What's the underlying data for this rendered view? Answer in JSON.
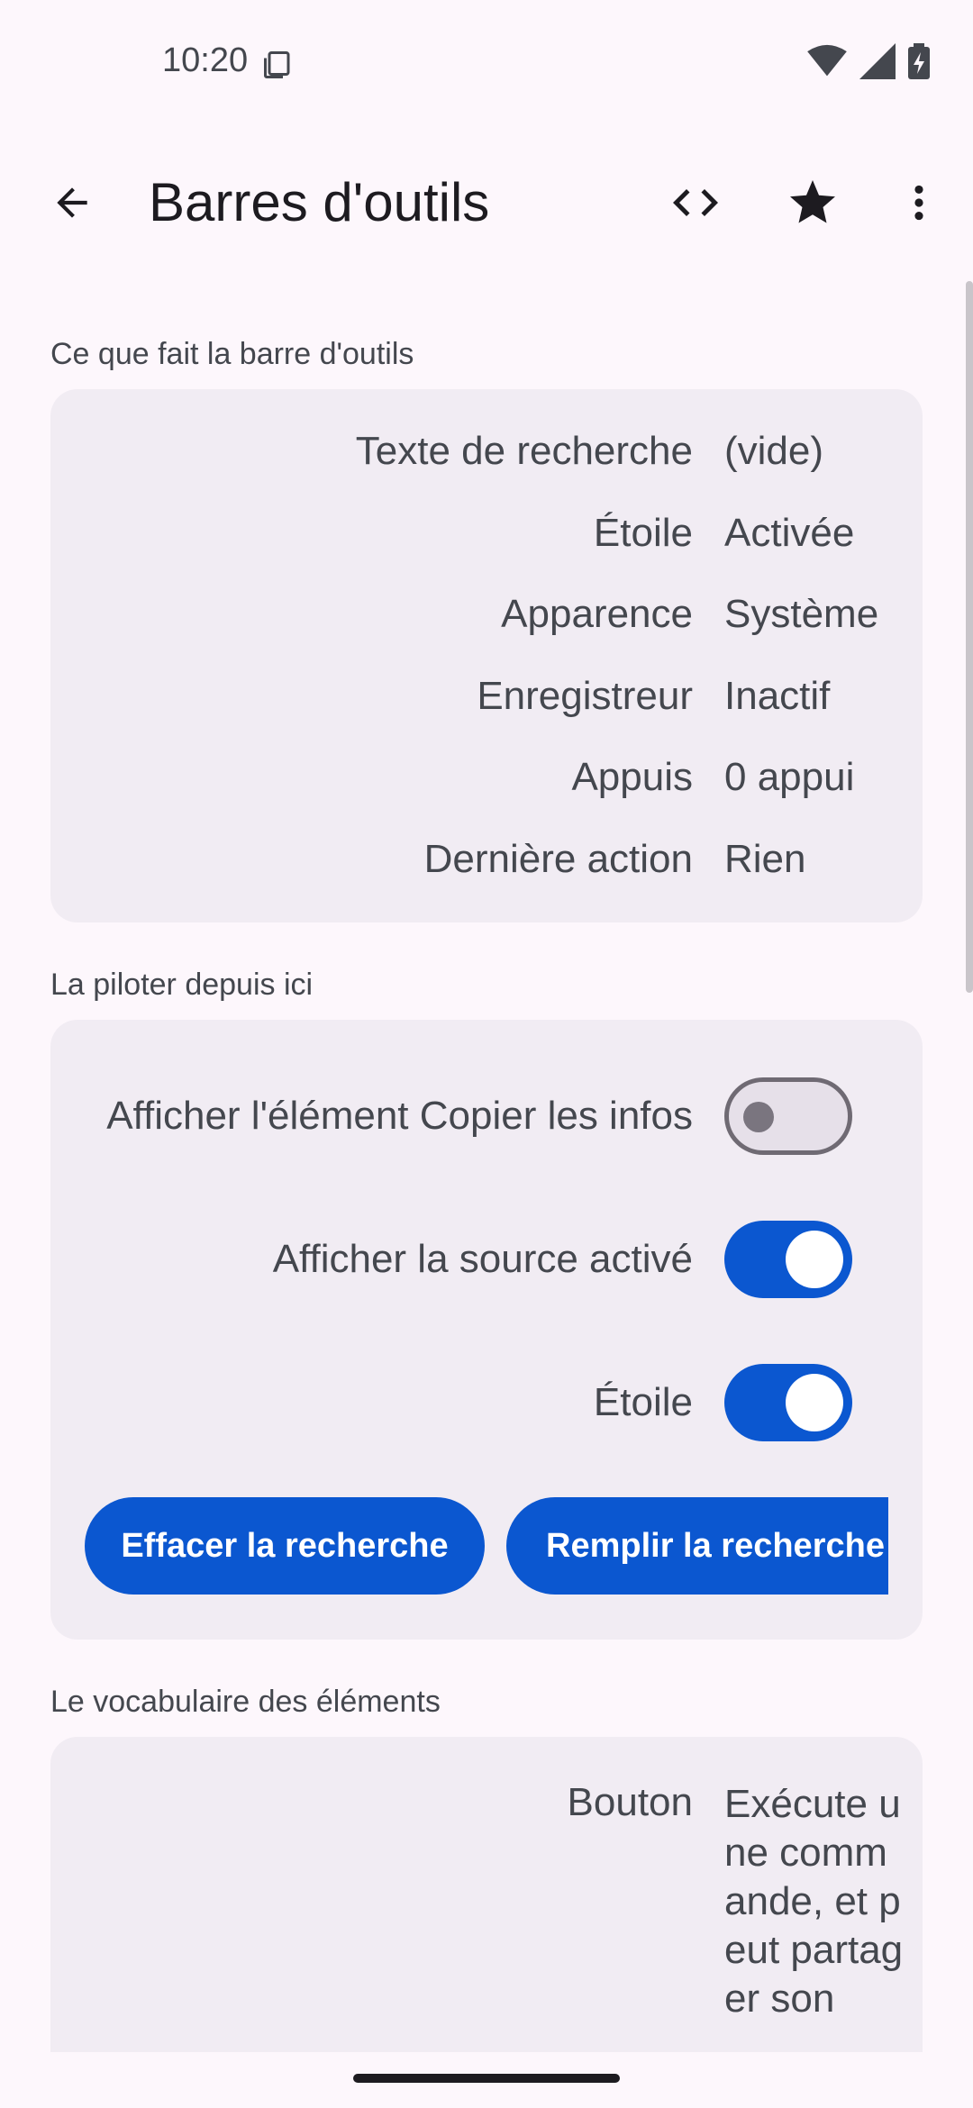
{
  "status_bar": {
    "time": "10:20"
  },
  "app_bar": {
    "title": "Barres d'outils"
  },
  "sections": {
    "what": {
      "label": "Ce que fait la barre d'outils",
      "rows": [
        {
          "key": "Texte de recherche",
          "value": "(vide)"
        },
        {
          "key": "Étoile",
          "value": "Activée"
        },
        {
          "key": "Apparence",
          "value": "Système"
        },
        {
          "key": "Enregistreur",
          "value": "Inactif"
        },
        {
          "key": "Appuis",
          "value": "0 appui"
        },
        {
          "key": "Dernière action",
          "value": "Rien"
        }
      ]
    },
    "control": {
      "label": "La piloter depuis ici",
      "toggles": [
        {
          "label": "Afficher l'élément Copier les infos",
          "on": false
        },
        {
          "label": "Afficher la source activé",
          "on": true
        },
        {
          "label": "Étoile",
          "on": true
        }
      ],
      "buttons": {
        "clear": "Effacer la recherche",
        "fill": "Remplir la recherche"
      }
    },
    "vocab": {
      "label": "Le vocabulaire des éléments",
      "rows": [
        {
          "key": "Bouton",
          "value": "Exécute une commande, et peut partager son"
        }
      ]
    }
  },
  "colors": {
    "accent": "#0b57d0",
    "background": "#fdf7fc",
    "card": "#f1ecf3"
  }
}
